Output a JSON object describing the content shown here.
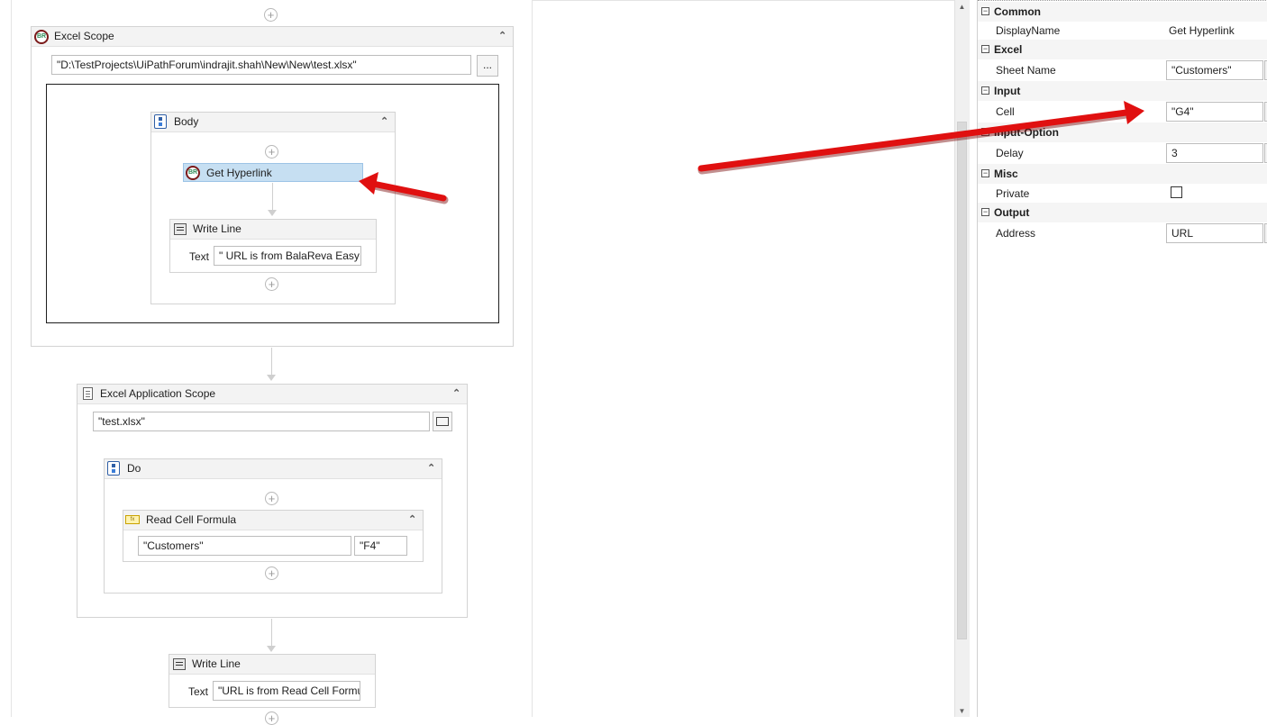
{
  "designer": {
    "excel_scope": {
      "title": "Excel Scope",
      "path_value": "\"D:\\TestProjects\\UiPathForum\\indrajit.shah\\New\\New\\test.xlsx\"",
      "browse_label": "...",
      "body": {
        "title": "Body",
        "get_hyperlink": {
          "title": "Get Hyperlink"
        },
        "write_line": {
          "title": "Write Line",
          "text_label": "Text",
          "text_value": "\" URL is from BalaReva Easy e"
        }
      }
    },
    "excel_app_scope": {
      "title": "Excel Application Scope",
      "path_value": "\"test.xlsx\"",
      "do": {
        "title": "Do",
        "read_cell_formula": {
          "title": "Read Cell Formula",
          "sheet_value": "\"Customers\"",
          "cell_value": "\"F4\""
        }
      }
    },
    "write_line_2": {
      "title": "Write Line",
      "text_label": "Text",
      "text_value": "\"URL is from Read Cell Formu"
    },
    "add_glyph": "+",
    "collapse_glyph": "⌃"
  },
  "properties": {
    "categories": [
      {
        "label": "Common",
        "toggle": "−"
      },
      {
        "label": "Excel",
        "toggle": "−"
      },
      {
        "label": "Input",
        "toggle": "−"
      },
      {
        "label": "Input-Option",
        "toggle": "−"
      },
      {
        "label": "Misc",
        "toggle": "−"
      },
      {
        "label": "Output",
        "toggle": "−"
      }
    ],
    "rows": {
      "display_name": {
        "label": "DisplayName",
        "value": "Get Hyperlink"
      },
      "sheet_name": {
        "label": "Sheet Name",
        "value": "\"Customers\""
      },
      "cell": {
        "label": "Cell",
        "value": "\"G4\""
      },
      "delay": {
        "label": "Delay",
        "value": "3"
      },
      "private": {
        "label": "Private",
        "checked": false
      },
      "address": {
        "label": "Address",
        "value": "URL"
      }
    }
  },
  "colors": {
    "annotation_arrow": "#e01010",
    "selected_activity": "#c6dff2"
  }
}
